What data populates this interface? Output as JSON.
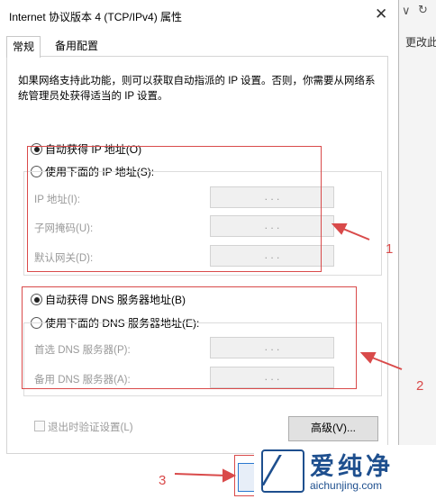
{
  "background_window": {
    "chevron_glyph": "∨",
    "refresh_glyph": "↻",
    "peek_text": "更改此"
  },
  "dialog": {
    "title": "Internet 协议版本 4 (TCP/IPv4) 属性",
    "close_glyph": "✕",
    "tabs": [
      {
        "label": "常规",
        "active": true
      },
      {
        "label": "备用配置",
        "active": false
      }
    ],
    "description": "如果网络支持此功能，则可以获取自动指派的 IP 设置。否则，你需要从网络系统管理员处获得适当的 IP 设置。",
    "ip_section": {
      "auto_label": "自动获得 IP 地址(O)",
      "auto_selected": true,
      "manual_label": "使用下面的 IP 地址(S):",
      "manual_selected": false,
      "fields": [
        {
          "label": "IP 地址(I):",
          "value": ". . ."
        },
        {
          "label": "子网掩码(U):",
          "value": ". . ."
        },
        {
          "label": "默认网关(D):",
          "value": ". . ."
        }
      ]
    },
    "dns_section": {
      "auto_label": "自动获得 DNS 服务器地址(B)",
      "auto_selected": true,
      "manual_label": "使用下面的 DNS 服务器地址(E):",
      "manual_selected": false,
      "fields": [
        {
          "label": "首选 DNS 服务器(P):",
          "value": ". . ."
        },
        {
          "label": "备用 DNS 服务器(A):",
          "value": ". . ."
        }
      ]
    },
    "validate_label": "退出时验证设置(L)",
    "validate_checked": false,
    "advanced_label": "高级(V)..."
  },
  "annotations": {
    "color": "#d94a4a",
    "labels": [
      "1",
      "2",
      "3"
    ]
  },
  "watermark": {
    "text": "爱纯净",
    "url": "aichunjing.com",
    "color": "#1e4f8e"
  }
}
